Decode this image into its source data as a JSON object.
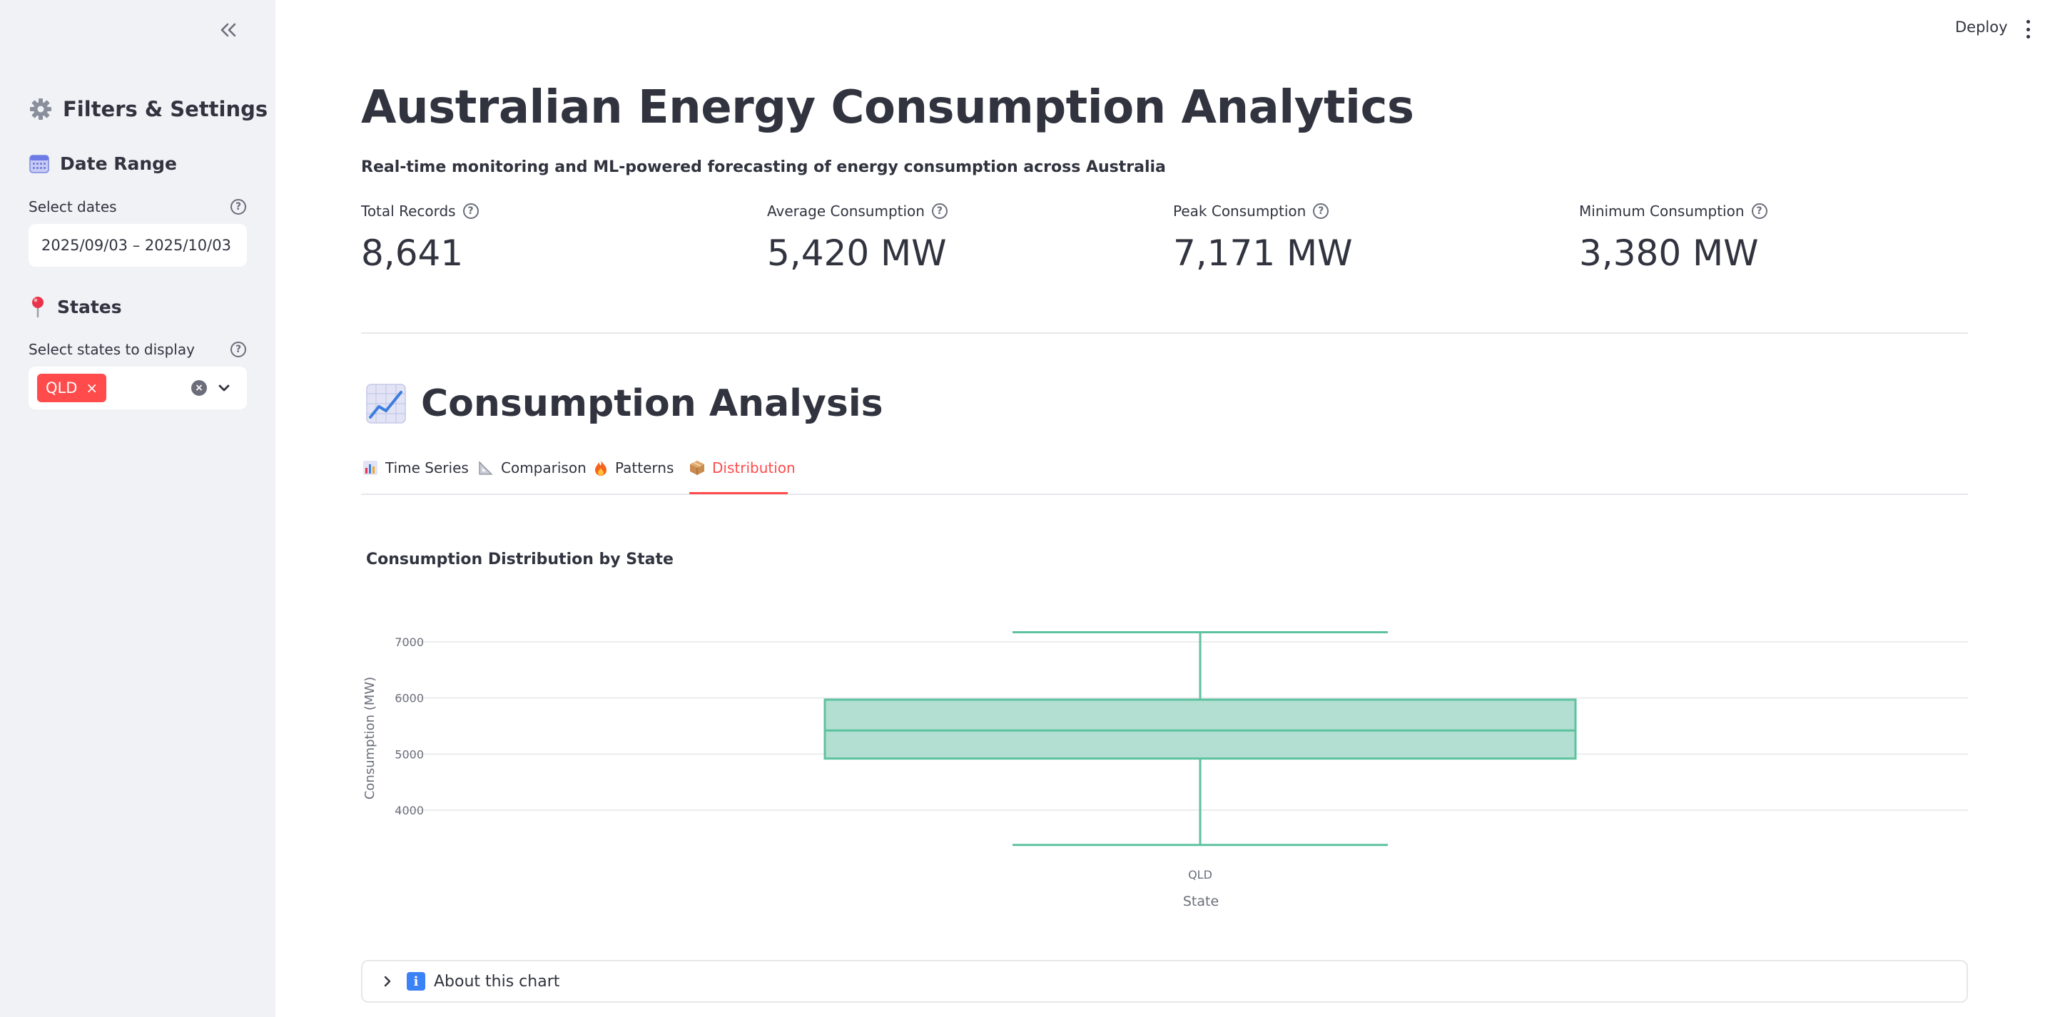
{
  "sidebar": {
    "title": "Filters & Settings",
    "date_section": {
      "heading": "Date Range",
      "label": "Select dates",
      "value": "2025/09/03 – 2025/10/03"
    },
    "states_section": {
      "heading": "States",
      "label": "Select states to display",
      "selected": [
        "QLD"
      ]
    }
  },
  "header": {
    "deploy_label": "Deploy"
  },
  "main": {
    "title": "Australian Energy Consumption Analytics",
    "subtitle": "Real-time monitoring and ML-powered forecasting of energy consumption across Australia",
    "metrics": [
      {
        "label": "Total Records",
        "value": "8,641"
      },
      {
        "label": "Average Consumption",
        "value": "5,420 MW"
      },
      {
        "label": "Peak Consumption",
        "value": "7,171 MW"
      },
      {
        "label": "Minimum Consumption",
        "value": "3,380 MW"
      }
    ],
    "section_heading": "Consumption Analysis",
    "tabs": [
      {
        "label": "Time Series",
        "active": false
      },
      {
        "label": "Comparison",
        "active": false
      },
      {
        "label": "Patterns",
        "active": false
      },
      {
        "label": "Distribution",
        "active": true
      }
    ],
    "expander_label": "About this chart"
  },
  "colors": {
    "accent": "#ff4b4b",
    "box_fill": "#b2dfd1",
    "box_stroke": "#5ec29f"
  },
  "chart_data": {
    "type": "box",
    "title": "Consumption Distribution by State",
    "xlabel": "State",
    "ylabel": "Consumption (MW)",
    "categories": [
      "QLD"
    ],
    "yticks": [
      4000,
      5000,
      6000,
      7000
    ],
    "ylim": [
      3300,
      7300
    ],
    "grid": true,
    "boxes": [
      {
        "category": "QLD",
        "min": 3380,
        "q1": 4920,
        "median": 5420,
        "q3": 5970,
        "max": 7171
      }
    ]
  }
}
